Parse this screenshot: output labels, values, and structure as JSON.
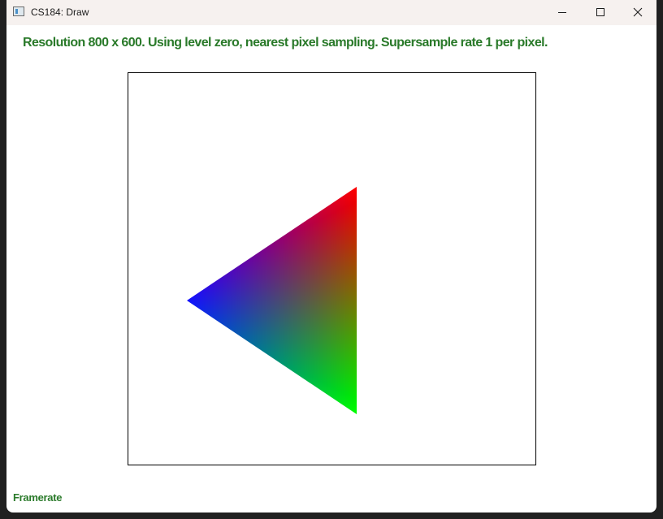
{
  "window": {
    "title": "CS184: Draw"
  },
  "titlebar_icons": {
    "app": "app-window-icon",
    "minimize": "minimize-icon",
    "maximize": "maximize-icon",
    "close": "close-icon"
  },
  "overlay": {
    "status_text": "Resolution 800 x 600. Using level zero, nearest pixel sampling. Supersample rate 1 per pixel.",
    "framerate_label": "Framerate",
    "text_color": "#2a7a2a"
  },
  "scene": {
    "triangle": {
      "vertex_colors": {
        "top": "#ff0000",
        "left": "#0000ff",
        "bottom": "#00ff00"
      }
    }
  }
}
